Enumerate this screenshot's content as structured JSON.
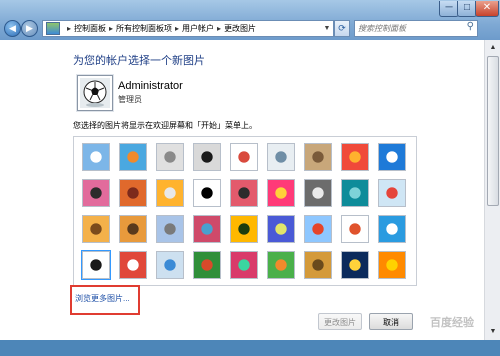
{
  "window": {
    "minimize": "─",
    "maximize": "□",
    "close": "✕"
  },
  "address": {
    "crumbs": [
      "控制面板",
      "所有控制面板项",
      "用户帐户",
      "更改图片"
    ],
    "separator": "▸"
  },
  "search": {
    "placeholder": "搜索控制面板"
  },
  "page": {
    "heading": "为您的帐户选择一个新图片",
    "user_name": "Administrator",
    "user_role": "管理员",
    "description": "您选择的图片将显示在欢迎屏幕和「开始」菜单上。",
    "browse_link": "浏览更多图片...",
    "change_button": "更改图片",
    "cancel_button": "取消"
  },
  "watermark": "百度经验",
  "pictures": [
    {
      "name": "ferris-wheel",
      "colors": [
        "#7cb6e8",
        "#ffffff"
      ]
    },
    {
      "name": "starfish",
      "colors": [
        "#4aa8e0",
        "#f08a2c"
      ]
    },
    {
      "name": "robot",
      "colors": [
        "#e0e0e0",
        "#8a8a8a"
      ]
    },
    {
      "name": "turntable",
      "colors": [
        "#d9d9d9",
        "#1a1a1a"
      ]
    },
    {
      "name": "lucky-cat",
      "colors": [
        "#ffffff",
        "#d94a3d"
      ]
    },
    {
      "name": "globe",
      "colors": [
        "#e8eef2",
        "#6f8ea6"
      ]
    },
    {
      "name": "kitten",
      "colors": [
        "#c8a77a",
        "#7a5a3a"
      ]
    },
    {
      "name": "red-flower",
      "colors": [
        "#f04a3a",
        "#ffb22e"
      ]
    },
    {
      "name": "blue-petals",
      "colors": [
        "#1e7ad8",
        "#ffffff"
      ]
    },
    {
      "name": "ball",
      "colors": [
        "#e26b9c",
        "#2c2c2c"
      ]
    },
    {
      "name": "mosaic",
      "colors": [
        "#e0692c",
        "#7c2a1c"
      ]
    },
    {
      "name": "orange-leaf",
      "colors": [
        "#ffb32e",
        "#e8e8e8"
      ]
    },
    {
      "name": "dog",
      "colors": [
        "#ffffff",
        "#000000"
      ]
    },
    {
      "name": "shoes",
      "colors": [
        "#e35a6c",
        "#2c2c2c"
      ]
    },
    {
      "name": "pink-star",
      "colors": [
        "#ff3a78",
        "#ffd23a"
      ]
    },
    {
      "name": "dice",
      "colors": [
        "#6c6c6c",
        "#eaeaea"
      ]
    },
    {
      "name": "teal-stairs",
      "colors": [
        "#0e8c9a",
        "#7ed3d8"
      ]
    },
    {
      "name": "paper-crane",
      "colors": [
        "#cfe6f5",
        "#e5453a"
      ]
    },
    {
      "name": "guitar",
      "colors": [
        "#f4b14a",
        "#7a4a1c"
      ]
    },
    {
      "name": "puppy",
      "colors": [
        "#e89a3c",
        "#5a3a1c"
      ]
    },
    {
      "name": "robot-toy",
      "colors": [
        "#a9c4e8",
        "#7a7a7a"
      ]
    },
    {
      "name": "fabric",
      "colors": [
        "#cf4a6a",
        "#4aa0cf"
      ]
    },
    {
      "name": "sunflower",
      "colors": [
        "#ffb800",
        "#1b3d0e"
      ]
    },
    {
      "name": "purple-flower",
      "colors": [
        "#4a5ad6",
        "#e1e56a"
      ]
    },
    {
      "name": "balloon",
      "colors": [
        "#8ec7ff",
        "#e5452a"
      ]
    },
    {
      "name": "doll",
      "colors": [
        "#ffffff",
        "#e0532c"
      ]
    },
    {
      "name": "sailboat",
      "colors": [
        "#2a9be0",
        "#ffffff"
      ]
    },
    {
      "name": "soccer-ball",
      "colors": [
        "#ffffff",
        "#1a1a1a"
      ],
      "selected": true
    },
    {
      "name": "red-pattern",
      "colors": [
        "#e0483a",
        "#ffffff"
      ]
    },
    {
      "name": "marbles",
      "colors": [
        "#cde0f0",
        "#3a8ad6"
      ]
    },
    {
      "name": "window",
      "colors": [
        "#2f8f3a",
        "#d94a2a"
      ]
    },
    {
      "name": "colorful-fabric",
      "colors": [
        "#d93a6a",
        "#3ad6a0"
      ]
    },
    {
      "name": "butterfly",
      "colors": [
        "#4ab04a",
        "#f08a2c"
      ]
    },
    {
      "name": "spiral",
      "colors": [
        "#d49a3a",
        "#6a4a1c"
      ]
    },
    {
      "name": "lighthouse",
      "colors": [
        "#0a2a5c",
        "#ffd23a"
      ]
    },
    {
      "name": "gerbera",
      "colors": [
        "#ff8a00",
        "#ffd200"
      ]
    }
  ]
}
